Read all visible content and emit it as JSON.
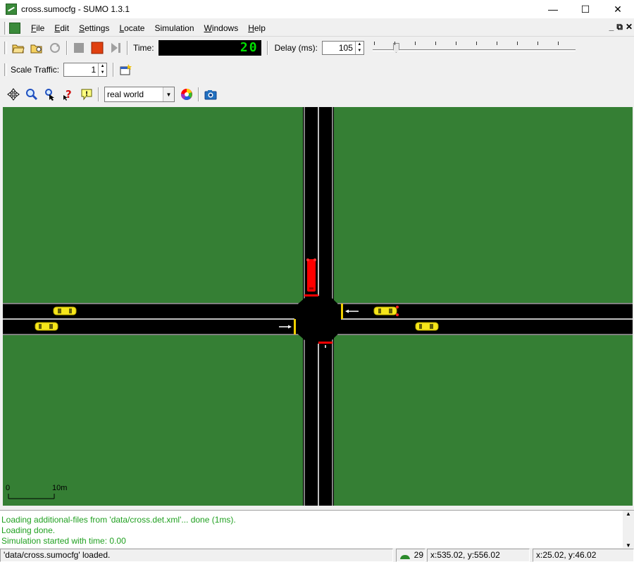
{
  "window": {
    "title": "cross.sumocfg - SUMO 1.3.1",
    "minimize_glyph": "—",
    "maximize_glyph": "☐",
    "close_glyph": "✕"
  },
  "menu": {
    "items": [
      {
        "label": "File",
        "accel": "F",
        "rest": "ile"
      },
      {
        "label": "Edit",
        "accel": "E",
        "rest": "dit"
      },
      {
        "label": "Settings",
        "accel": "S",
        "rest": "ettings"
      },
      {
        "label": "Locate",
        "accel": "L",
        "rest": "ocate"
      },
      {
        "label": "Simulation",
        "accel": "",
        "rest": "Simulation"
      },
      {
        "label": "Windows",
        "accel": "W",
        "rest": "indows"
      },
      {
        "label": "Help",
        "accel": "H",
        "rest": "elp"
      }
    ],
    "mdi": {
      "minimize": "_",
      "restore": "⧉",
      "close": "✕"
    }
  },
  "toolbar": {
    "time_label": "Time:",
    "time_value": "20",
    "delay_label": "Delay (ms):",
    "delay_value": "105",
    "scale_label": "Scale Traffic:",
    "scale_value": "1"
  },
  "viewbar": {
    "scheme_value": "real world"
  },
  "canvas": {
    "scale_start": "0",
    "scale_end": "10m"
  },
  "messages": [
    "Loading additional-files from 'data/cross.det.xml'... done (1ms).",
    "Loading done.",
    "Simulation started with time: 0.00"
  ],
  "status": {
    "text": "'data/cross.sumocfg' loaded.",
    "vehicle_count": "29",
    "cursor_coords": "x:535.02, y:556.02",
    "geo_coords": "x:25.02, y:46.02"
  },
  "colors": {
    "grass": "#357f34",
    "road": "#000000",
    "vehicle": "#f6e61a",
    "red_signal": "#ff0000",
    "yellow_signal": "#f0d000",
    "lcd_text": "#00e000"
  },
  "icons": [
    "open-icon",
    "open-network-icon",
    "reload-icon",
    "stop-icon",
    "run-icon",
    "step-icon",
    "edit-chosen-icon",
    "recenter-icon",
    "zoom-icon",
    "locate-icon",
    "query-icon",
    "tooltip-icon",
    "colorwheel-icon",
    "snapshot-icon"
  ]
}
